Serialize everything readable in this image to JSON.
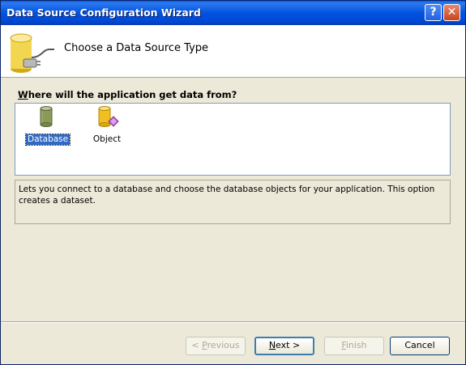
{
  "window": {
    "title": "Data Source Configuration Wizard",
    "help_glyph": "?",
    "close_glyph": "✕"
  },
  "header": {
    "title": "Choose a Data Source Type",
    "icon": "database-plug-icon"
  },
  "prompt": {
    "accesskey": "W",
    "rest": "here will the application get data from?"
  },
  "data_sources": [
    {
      "label": "Database",
      "icon": "database-icon",
      "selected": true
    },
    {
      "label": "Object",
      "icon": "object-data-source-icon",
      "selected": false
    }
  ],
  "description": "Lets you connect to a database and choose the database objects for your application. This option creates a dataset.",
  "buttons": {
    "previous": {
      "prefix": "< ",
      "accesskey": "P",
      "rest": "revious",
      "enabled": false
    },
    "next": {
      "accesskey": "N",
      "rest": "ext >",
      "enabled": true
    },
    "finish": {
      "accesskey": "F",
      "rest": "inish",
      "enabled": false
    },
    "cancel": {
      "label": "Cancel",
      "enabled": true
    }
  },
  "colors": {
    "titlebar": "#0153e0",
    "selection": "#316ac5",
    "dialog_bg": "#ece9d8"
  }
}
